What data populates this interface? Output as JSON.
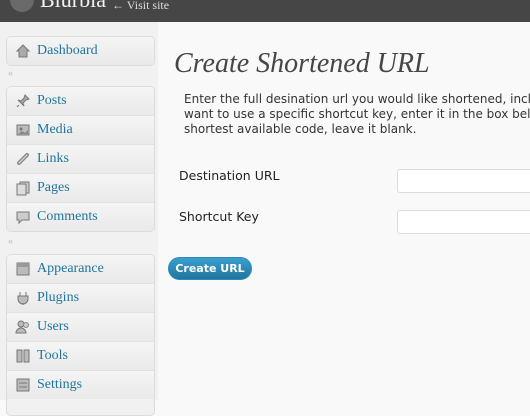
{
  "topbar": {
    "site_title": "Blurbia",
    "visit_site": "← Visit site"
  },
  "sidebar": {
    "groups": [
      {
        "items": [
          {
            "label": "Dashboard",
            "icon": "home-icon"
          }
        ]
      },
      {
        "items": [
          {
            "label": "Posts",
            "icon": "pushpin-icon"
          },
          {
            "label": "Media",
            "icon": "media-icon"
          },
          {
            "label": "Links",
            "icon": "link-icon"
          },
          {
            "label": "Pages",
            "icon": "pages-icon"
          },
          {
            "label": "Comments",
            "icon": "comment-icon"
          }
        ]
      },
      {
        "items": [
          {
            "label": "Appearance",
            "icon": "appearance-icon"
          },
          {
            "label": "Plugins",
            "icon": "plugin-icon"
          },
          {
            "label": "Users",
            "icon": "users-icon"
          },
          {
            "label": "Tools",
            "icon": "tools-icon"
          },
          {
            "label": "Settings",
            "icon": "settings-icon"
          }
        ]
      }
    ],
    "separator": "«"
  },
  "main": {
    "title": "Create Shortened URL",
    "description_lines": [
      "Enter the full desination url you would like shortened, includ",
      "want to use a specific shortcut key, enter it in the box below",
      "shortest available code, leave it blank."
    ],
    "form": {
      "destination_label": "Destination URL",
      "destination_value": "",
      "shortcut_label": "Shortcut Key",
      "shortcut_value": "",
      "submit_label": "Create URL"
    }
  },
  "colors": {
    "topbar": "#464646",
    "link": "#21759b",
    "button": "#21759b"
  }
}
